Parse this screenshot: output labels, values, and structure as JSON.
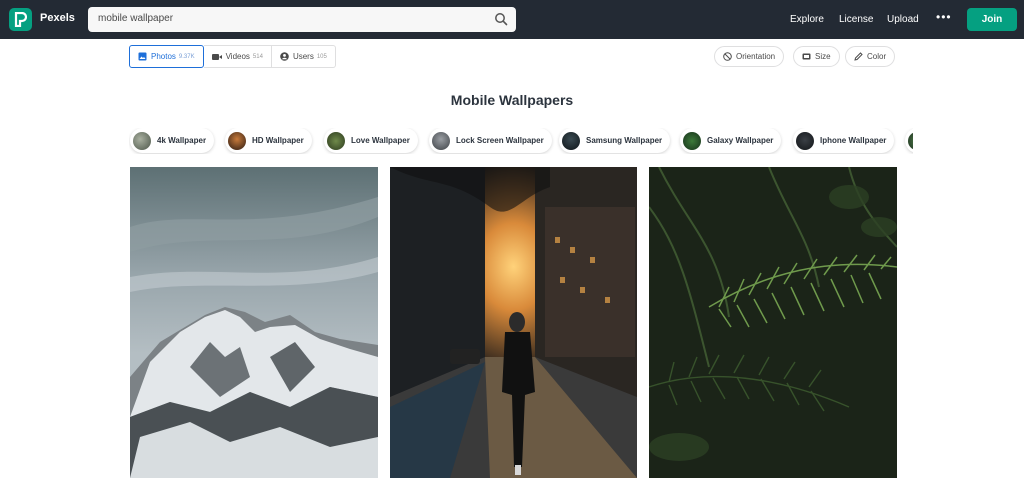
{
  "header": {
    "brand": "Pexels",
    "search_value": "mobile wallpaper",
    "nav": {
      "explore": "Explore",
      "license": "License",
      "upload": "Upload",
      "more": "•••"
    },
    "join_label": "Join",
    "colors": {
      "bar": "#232a34",
      "accent": "#05a081"
    }
  },
  "tabs": [
    {
      "label": "Photos",
      "count": "9.37K",
      "active": true
    },
    {
      "label": "Videos",
      "count": "514",
      "active": false
    },
    {
      "label": "Users",
      "count": "105",
      "active": false
    }
  ],
  "filters": {
    "orientation": "Orientation",
    "size": "Size",
    "color": "Color"
  },
  "page_title": "Mobile Wallpapers",
  "chips": [
    {
      "label": "4k Wallpaper"
    },
    {
      "label": "HD Wallpaper"
    },
    {
      "label": "Love Wallpaper"
    },
    {
      "label": "Lock Screen Wallpaper"
    },
    {
      "label": "Samsung Wallpaper"
    },
    {
      "label": "Galaxy Wallpaper"
    },
    {
      "label": "Iphone Wallpaper"
    }
  ],
  "photos": [
    {
      "subject": "snowy-mountain-photo"
    },
    {
      "subject": "city-street-sunset-photo"
    },
    {
      "subject": "fern-leaves-photo"
    }
  ]
}
